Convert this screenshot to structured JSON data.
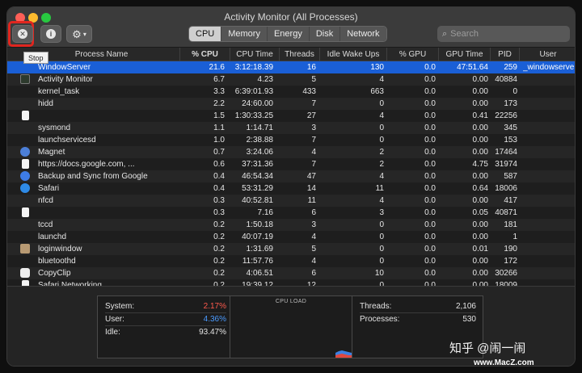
{
  "window": {
    "title": "Activity Monitor (All Processes)"
  },
  "toolbar": {
    "stop_tooltip": "Stop"
  },
  "tabs": [
    {
      "label": "CPU",
      "active": true
    },
    {
      "label": "Memory",
      "active": false
    },
    {
      "label": "Energy",
      "active": false
    },
    {
      "label": "Disk",
      "active": false
    },
    {
      "label": "Network",
      "active": false
    }
  ],
  "search": {
    "placeholder": "Search"
  },
  "columns": {
    "name": "Process Name",
    "cpu": "% CPU",
    "cpu_time": "CPU Time",
    "threads": "Threads",
    "idle_wake": "Idle Wake Ups",
    "gpu": "% GPU",
    "gpu_time": "GPU Time",
    "pid": "PID",
    "user": "User"
  },
  "processes": [
    {
      "name": "WindowServer",
      "icon": "none",
      "cpu": "21.6",
      "cpu_time": "3:12:18.39",
      "threads": "16",
      "idle_wake": "130",
      "gpu": "0.0",
      "gpu_time": "47:51.64",
      "pid": "259",
      "user": "_windowserver",
      "selected": true
    },
    {
      "name": "Activity Monitor",
      "icon": "activity-monitor-icon",
      "cpu": "6.7",
      "cpu_time": "4.23",
      "threads": "5",
      "idle_wake": "4",
      "gpu": "0.0",
      "gpu_time": "0.00",
      "pid": "40884",
      "user": ""
    },
    {
      "name": "kernel_task",
      "icon": "none",
      "cpu": "3.3",
      "cpu_time": "6:39:01.93",
      "threads": "433",
      "idle_wake": "663",
      "gpu": "0.0",
      "gpu_time": "0.00",
      "pid": "0",
      "user": ""
    },
    {
      "name": "hidd",
      "icon": "none",
      "cpu": "2.2",
      "cpu_time": "24:60.00",
      "threads": "7",
      "idle_wake": "0",
      "gpu": "0.0",
      "gpu_time": "0.00",
      "pid": "173",
      "user": ""
    },
    {
      "name": "",
      "icon": "document-icon",
      "cpu": "1.5",
      "cpu_time": "1:30:33.25",
      "threads": "27",
      "idle_wake": "4",
      "gpu": "0.0",
      "gpu_time": "0.41",
      "pid": "22256",
      "user": ""
    },
    {
      "name": "sysmond",
      "icon": "none",
      "cpu": "1.1",
      "cpu_time": "1:14.71",
      "threads": "3",
      "idle_wake": "0",
      "gpu": "0.0",
      "gpu_time": "0.00",
      "pid": "345",
      "user": ""
    },
    {
      "name": "launchservicesd",
      "icon": "none",
      "cpu": "1.0",
      "cpu_time": "2:38.88",
      "threads": "7",
      "idle_wake": "0",
      "gpu": "0.0",
      "gpu_time": "0.00",
      "pid": "153",
      "user": ""
    },
    {
      "name": "Magnet",
      "icon": "magnet-icon",
      "cpu": "0.7",
      "cpu_time": "3:24.06",
      "threads": "4",
      "idle_wake": "2",
      "gpu": "0.0",
      "gpu_time": "0.00",
      "pid": "17464",
      "user": ""
    },
    {
      "name": "https://docs.google.com, ...",
      "icon": "document-icon",
      "cpu": "0.6",
      "cpu_time": "37:31.36",
      "threads": "7",
      "idle_wake": "2",
      "gpu": "0.0",
      "gpu_time": "4.75",
      "pid": "31974",
      "user": ""
    },
    {
      "name": "Backup and Sync from Google",
      "icon": "backup-sync-icon",
      "cpu": "0.4",
      "cpu_time": "46:54.34",
      "threads": "47",
      "idle_wake": "4",
      "gpu": "0.0",
      "gpu_time": "0.00",
      "pid": "587",
      "user": ""
    },
    {
      "name": "Safari",
      "icon": "safari-icon",
      "cpu": "0.4",
      "cpu_time": "53:31.29",
      "threads": "14",
      "idle_wake": "11",
      "gpu": "0.0",
      "gpu_time": "0.64",
      "pid": "18006",
      "user": ""
    },
    {
      "name": "nfcd",
      "icon": "none",
      "cpu": "0.3",
      "cpu_time": "40:52.81",
      "threads": "11",
      "idle_wake": "4",
      "gpu": "0.0",
      "gpu_time": "0.00",
      "pid": "417",
      "user": ""
    },
    {
      "name": "",
      "icon": "document-icon",
      "cpu": "0.3",
      "cpu_time": "7.16",
      "threads": "6",
      "idle_wake": "3",
      "gpu": "0.0",
      "gpu_time": "0.05",
      "pid": "40871",
      "user": ""
    },
    {
      "name": "tccd",
      "icon": "none",
      "cpu": "0.2",
      "cpu_time": "1:50.18",
      "threads": "3",
      "idle_wake": "0",
      "gpu": "0.0",
      "gpu_time": "0.00",
      "pid": "181",
      "user": ""
    },
    {
      "name": "launchd",
      "icon": "none",
      "cpu": "0.2",
      "cpu_time": "40:07.19",
      "threads": "4",
      "idle_wake": "0",
      "gpu": "0.0",
      "gpu_time": "0.00",
      "pid": "1",
      "user": ""
    },
    {
      "name": "loginwindow",
      "icon": "loginwindow-icon",
      "cpu": "0.2",
      "cpu_time": "1:31.69",
      "threads": "5",
      "idle_wake": "0",
      "gpu": "0.0",
      "gpu_time": "0.01",
      "pid": "190",
      "user": ""
    },
    {
      "name": "bluetoothd",
      "icon": "none",
      "cpu": "0.2",
      "cpu_time": "11:57.76",
      "threads": "4",
      "idle_wake": "0",
      "gpu": "0.0",
      "gpu_time": "0.00",
      "pid": "172",
      "user": ""
    },
    {
      "name": "CopyClip",
      "icon": "copyclip-icon",
      "cpu": "0.2",
      "cpu_time": "4:06.51",
      "threads": "6",
      "idle_wake": "10",
      "gpu": "0.0",
      "gpu_time": "0.00",
      "pid": "30266",
      "user": ""
    },
    {
      "name": "Safari Networking",
      "icon": "document-icon",
      "cpu": "0.2",
      "cpu_time": "19:39.12",
      "threads": "12",
      "idle_wake": "0",
      "gpu": "0.0",
      "gpu_time": "0.00",
      "pid": "18009",
      "user": ""
    }
  ],
  "summary": {
    "system_label": "System:",
    "system_value": "2.17%",
    "user_label": "User:",
    "user_value": "4.36%",
    "idle_label": "Idle:",
    "idle_value": "93.47%",
    "cpu_load_label": "CPU LOAD",
    "threads_label": "Threads:",
    "threads_value": "2,106",
    "processes_label": "Processes:",
    "processes_value": "530"
  },
  "watermark": {
    "text": "知乎 @闹一闹",
    "site": "www.MacZ.com"
  },
  "colors": {
    "selection": "#1a5fd6",
    "system": "#ff5a4d",
    "user": "#4b9bff",
    "stop_highlight": "#e0261f"
  }
}
